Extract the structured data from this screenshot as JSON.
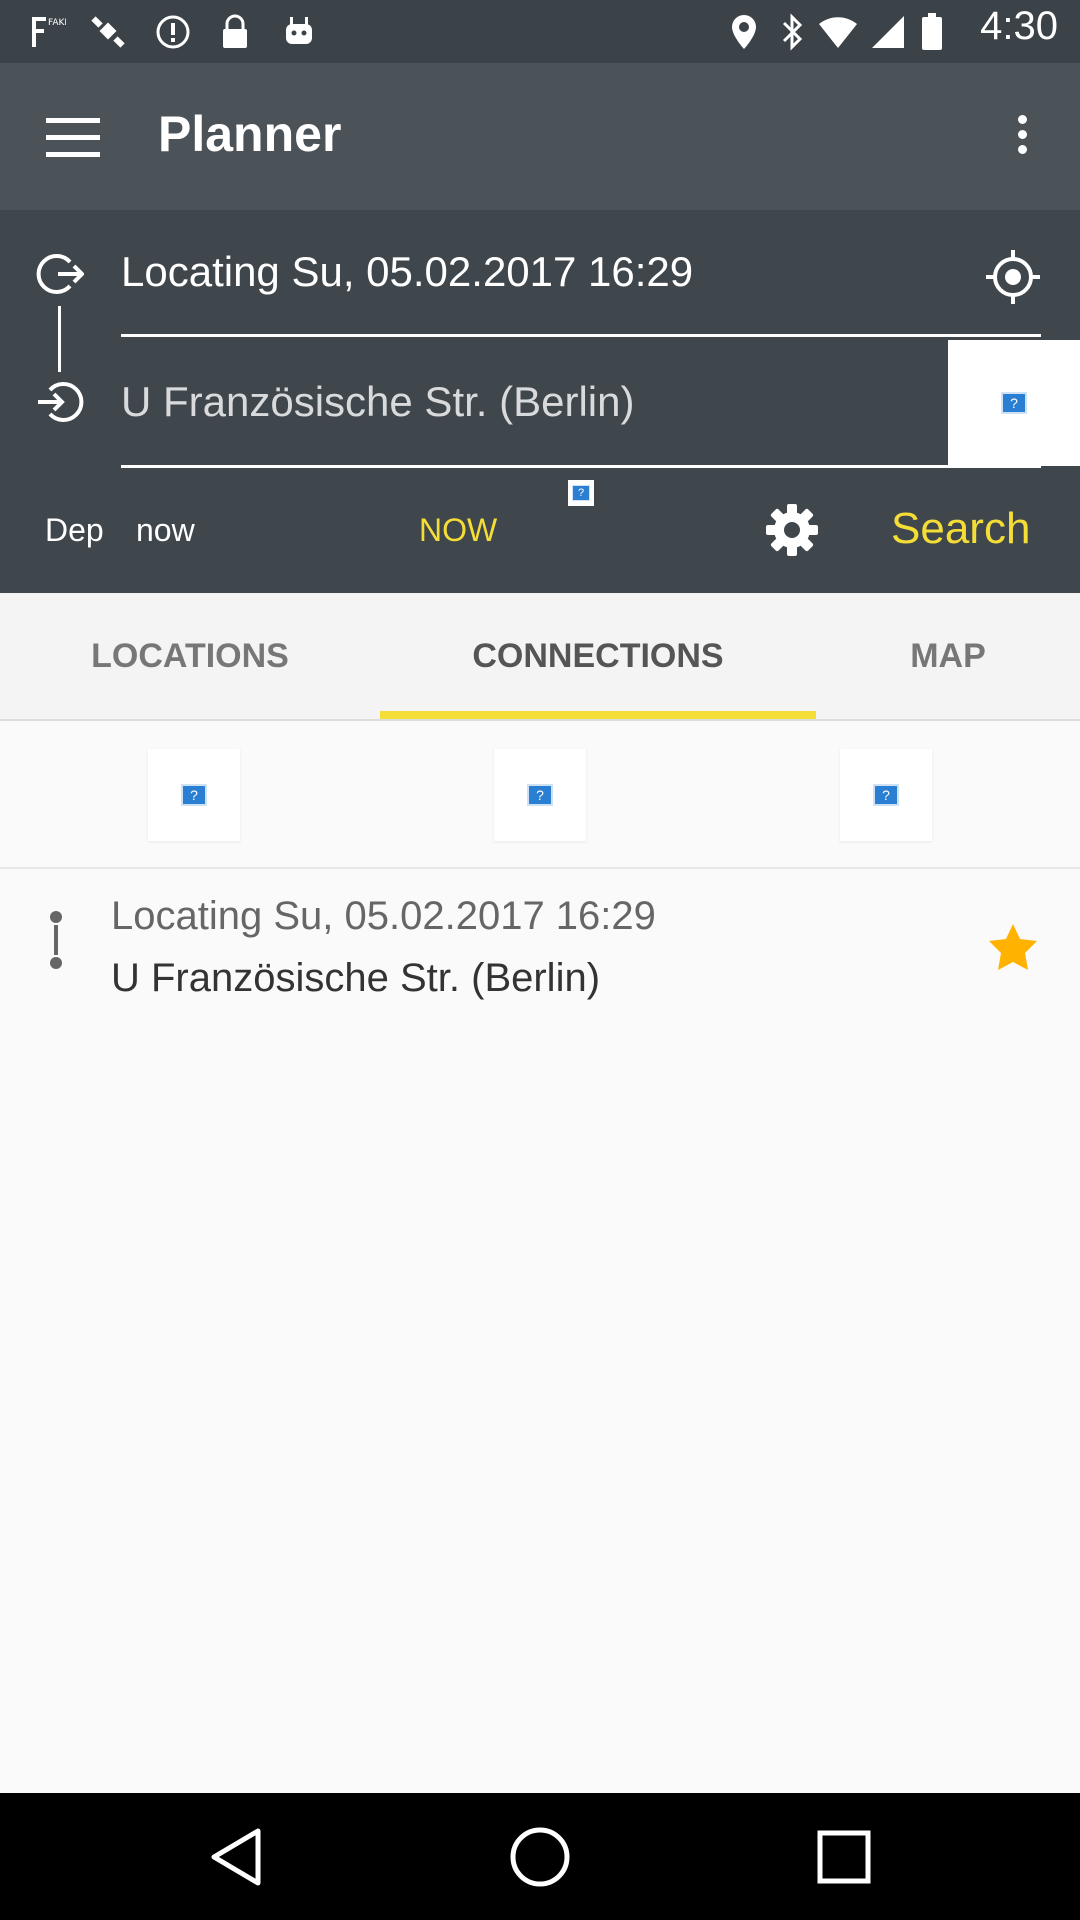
{
  "status_bar": {
    "time": "4:30",
    "left_icons": [
      "fake-gps-icon",
      "satellite-icon",
      "info-circle-icon",
      "lock-icon",
      "android-icon"
    ],
    "right_icons": [
      "location-pin-icon",
      "bluetooth-icon",
      "wifi-icon",
      "signal-icon",
      "battery-icon"
    ]
  },
  "app_bar": {
    "title": "Planner",
    "menu_icon": "hamburger-menu-icon",
    "overflow_icon": "overflow-menu-icon"
  },
  "planner": {
    "from_value": "Locating Su, 05.02.2017 16:29",
    "to_value": "U Französische Str. (Berlin)",
    "dep_label": "Dep",
    "dep_time": "now",
    "now_button": "NOW",
    "search_button": "Search",
    "accent_color": "#f4dd36"
  },
  "tabs": [
    {
      "label": "LOCATIONS",
      "active": false
    },
    {
      "label": "CONNECTIONS",
      "active": true
    },
    {
      "label": "MAP",
      "active": false
    }
  ],
  "history": [
    {
      "from": "Locating Su, 05.02.2017 16:29",
      "to": "U Französische Str. (Berlin)",
      "favorite": true
    }
  ],
  "colors": {
    "status_bar": "#3b4248",
    "app_bar": "#4b5258",
    "panel": "#3f464c",
    "accent": "#f4dd36",
    "star": "#ffb300"
  }
}
